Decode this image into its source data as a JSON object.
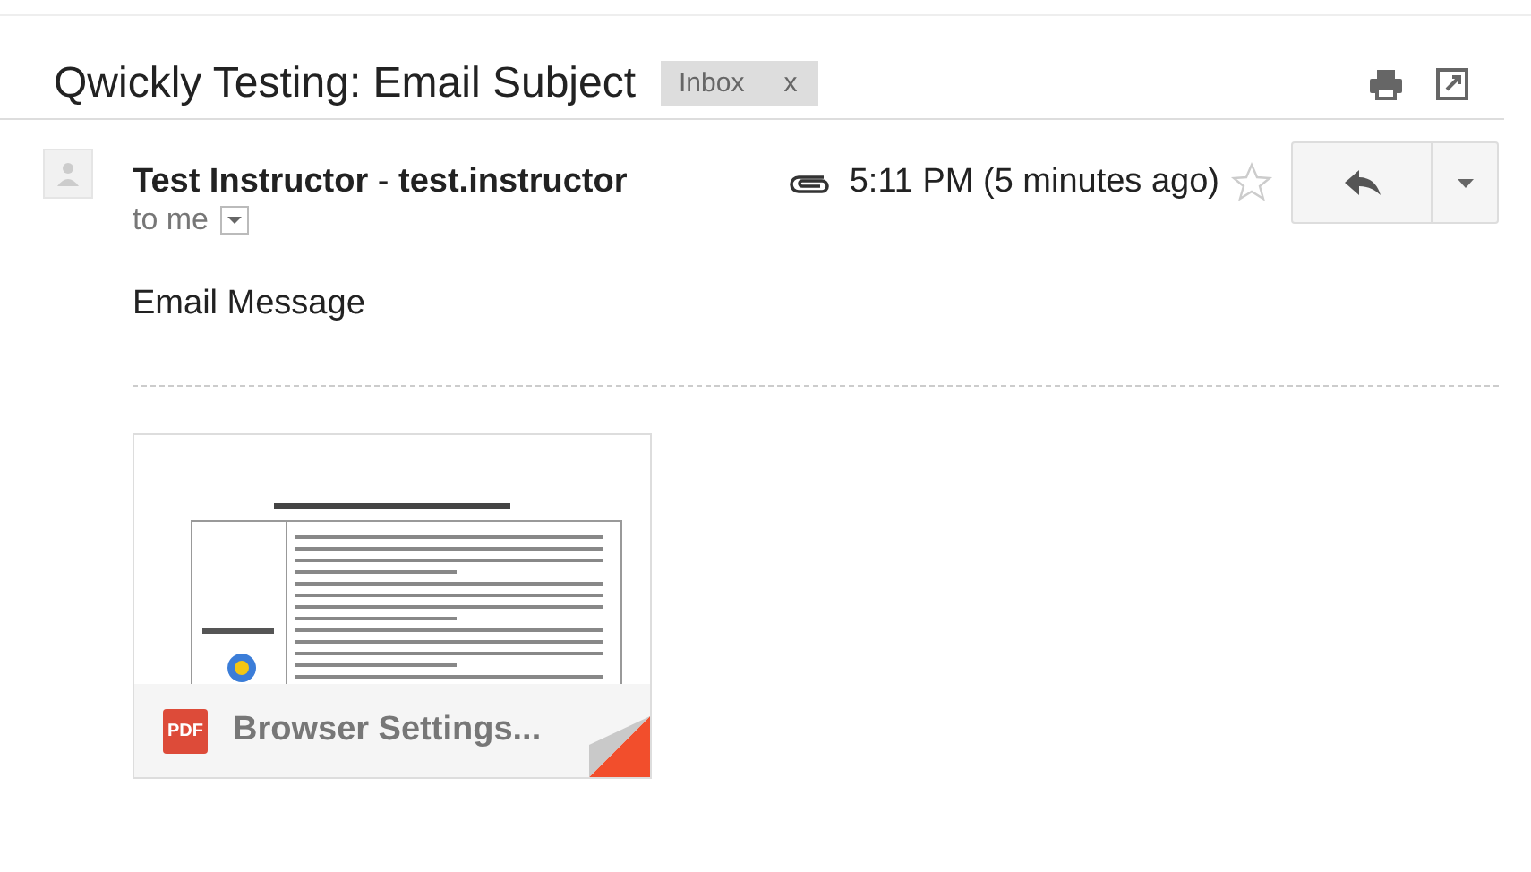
{
  "subject": "Qwickly Testing: Email Subject",
  "labels": [
    {
      "text": "Inbox",
      "remove": "x"
    }
  ],
  "message": {
    "sender": "**Test Instructor** - **test.instructor**",
    "has_attachment": true,
    "time": "5:11 PM (5 minutes ago)",
    "starred": false,
    "recipient": "to me",
    "body": "Email Message"
  },
  "attachments": [
    {
      "badge": "PDF",
      "name": "Browser Settings..."
    }
  ]
}
